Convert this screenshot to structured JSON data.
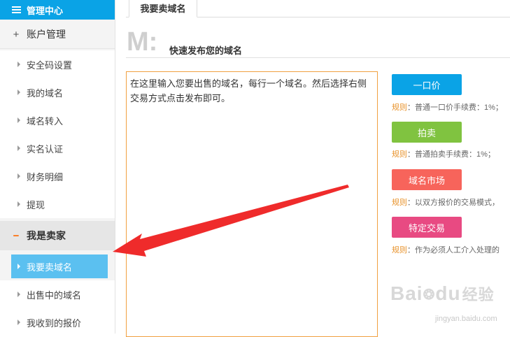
{
  "sidebar": {
    "header": {
      "label": "管理中心"
    },
    "groups": [
      {
        "sign": "+",
        "label": "账户管理",
        "items": [
          "安全码设置",
          "我的域名",
          "域名转入",
          "实名认证",
          "财务明细",
          "提现"
        ]
      },
      {
        "sign": "−",
        "label": "我是卖家",
        "items": [
          "我要卖域名",
          "出售中的域名",
          "我收到的报价"
        ]
      }
    ],
    "active_item": "我要卖域名"
  },
  "main": {
    "tab": "我要卖域名",
    "big_letter": "M:",
    "section_title": "快速发布您的域名",
    "textarea_placeholder": "在这里输入您要出售的域名，每行一个域名。然后选择右侧交易方式点击发布即可。",
    "actions": [
      {
        "label": "一口价",
        "color": "#0aa3e6",
        "rule_key": "规则",
        "rule_text": "：普通一口价手续费：1%；"
      },
      {
        "label": "拍卖",
        "color": "#80c340",
        "rule_key": "规则",
        "rule_text": "：普通拍卖手续费：1%；"
      },
      {
        "label": "域名市场",
        "color": "#f7645b",
        "rule_key": "规则",
        "rule_text": "：以双方报价的交易模式，"
      },
      {
        "label": "特定交易",
        "color": "#e84a82",
        "rule_key": "规则",
        "rule_text": "：作为必须人工介入处理的"
      }
    ]
  },
  "watermark": {
    "logo": "Bai",
    "logo2": "du",
    "logo3": "经验",
    "sub": "jingyan.baidu.com"
  }
}
